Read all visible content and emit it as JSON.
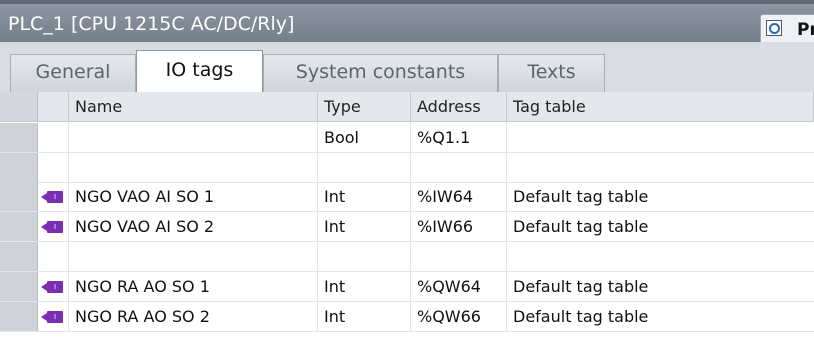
{
  "window": {
    "title": "PLC_1 [CPU 1215C AC/DC/Rly]",
    "properties_button_label": "Pr",
    "properties_icon": "properties-magnifier-icon"
  },
  "tabs": [
    {
      "label": "General",
      "active": false
    },
    {
      "label": "IO tags",
      "active": true
    },
    {
      "label": "System constants",
      "active": false
    },
    {
      "label": "Texts",
      "active": false
    }
  ],
  "table": {
    "columns": [
      "Name",
      "Type",
      "Address",
      "Tag table"
    ],
    "rows": [
      {
        "icon": "",
        "name": "",
        "type": "Bool",
        "address": "%Q1.1",
        "tag_table": ""
      },
      {
        "icon": "",
        "name": "",
        "type": "",
        "address": "",
        "tag_table": ""
      },
      {
        "icon": "tag-input-icon",
        "icon_text": "I",
        "name": "NGO VAO AI SO 1",
        "type": "Int",
        "address": "%IW64",
        "tag_table": "Default tag table"
      },
      {
        "icon": "tag-input-icon",
        "icon_text": "I",
        "name": "NGO VAO AI SO 2",
        "type": "Int",
        "address": "%IW66",
        "tag_table": "Default tag table"
      },
      {
        "icon": "",
        "name": "",
        "type": "",
        "address": "",
        "tag_table": ""
      },
      {
        "icon": "tag-input-icon",
        "icon_text": "I",
        "name": "NGO RA AO SO 1",
        "type": "Int",
        "address": "%QW64",
        "tag_table": "Default tag table"
      },
      {
        "icon": "tag-input-icon",
        "icon_text": "I",
        "name": "NGO RA AO SO 2",
        "type": "Int",
        "address": "%QW66",
        "tag_table": "Default tag table"
      }
    ]
  },
  "colors": {
    "titlebar": "#7d8893",
    "tag_icon": "#7a2fb0"
  }
}
